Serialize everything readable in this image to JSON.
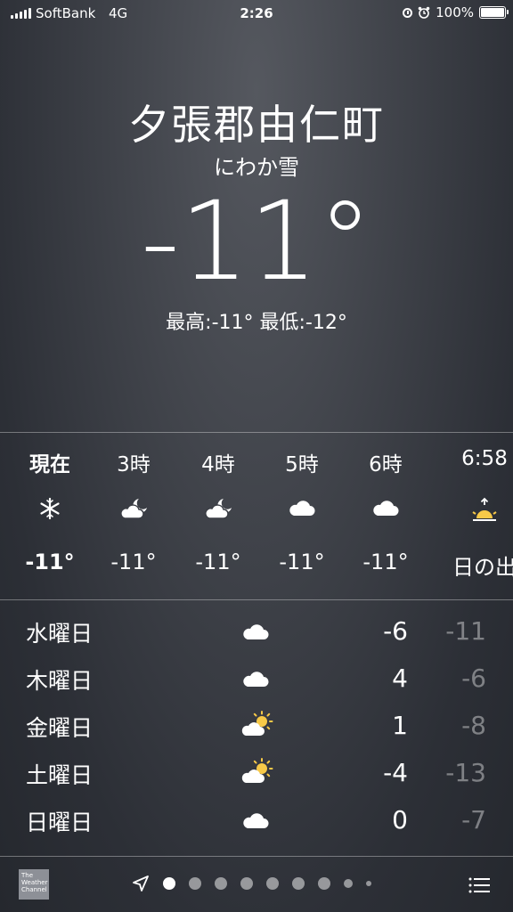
{
  "status_bar": {
    "carrier": "SoftBank",
    "network": "4G",
    "time": "2:26",
    "battery": "100%"
  },
  "header": {
    "city": "夕張郡由仁町",
    "condition": "にわか雪",
    "temperature": "-11°",
    "hilo": "最高:-11° 最低:-12°"
  },
  "hourly": [
    {
      "label": "現在",
      "icon": "snow-icon",
      "temp": "-11°"
    },
    {
      "label": "3時",
      "icon": "cloud-moon-icon",
      "temp": "-11°"
    },
    {
      "label": "4時",
      "icon": "cloud-moon-icon",
      "temp": "-11°"
    },
    {
      "label": "5時",
      "icon": "cloud-icon",
      "temp": "-11°"
    },
    {
      "label": "6時",
      "icon": "cloud-icon",
      "temp": "-11°"
    },
    {
      "label": "6:58",
      "icon": "sunrise-icon",
      "temp": "日の出"
    }
  ],
  "daily": [
    {
      "day": "水曜日",
      "icon": "cloud-icon",
      "high": "-6",
      "low": "-11"
    },
    {
      "day": "木曜日",
      "icon": "cloud-icon",
      "high": "4",
      "low": "-6"
    },
    {
      "day": "金曜日",
      "icon": "partly-sunny-icon",
      "high": "1",
      "low": "-8"
    },
    {
      "day": "土曜日",
      "icon": "partly-sunny-icon",
      "high": "-4",
      "low": "-13"
    },
    {
      "day": "日曜日",
      "icon": "cloud-icon",
      "high": "0",
      "low": "-7"
    }
  ],
  "bottom": {
    "logo_text": "The Weather Channel",
    "page_count": 9,
    "active_page": 1
  }
}
